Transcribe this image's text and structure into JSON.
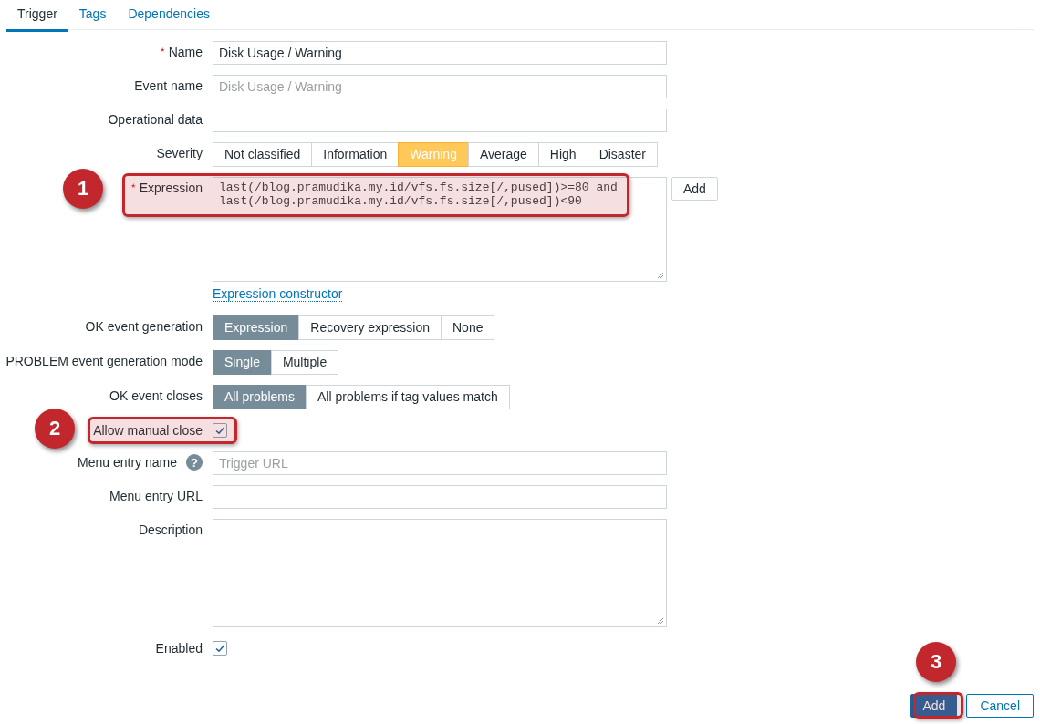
{
  "tabs": [
    {
      "label": "Trigger",
      "selected": true
    },
    {
      "label": "Tags",
      "selected": false
    },
    {
      "label": "Dependencies",
      "selected": false
    }
  ],
  "rows": [
    {
      "kind": "text",
      "label": "Name",
      "required": true,
      "value": "Disk Usage / Warning"
    },
    {
      "kind": "text",
      "label": "Event name",
      "required": false,
      "placeholder": "Disk Usage / Warning"
    },
    {
      "kind": "text",
      "label": "Operational data",
      "required": false
    },
    {
      "kind": "severity",
      "label": "Severity",
      "options": [
        {
          "label": "Not classified",
          "selected": false
        },
        {
          "label": "Information",
          "selected": false
        },
        {
          "label": "Warning",
          "selected": true
        },
        {
          "label": "Average",
          "selected": false
        },
        {
          "label": "High",
          "selected": false
        },
        {
          "label": "Disaster",
          "selected": false
        }
      ]
    },
    {
      "kind": "expression",
      "label": "Expression",
      "required": true,
      "value": "last(/blog.pramudika.my.id/vfs.fs.size[/,pused])>=80 and last(/blog.pramudika.my.id/vfs.fs.size[/,pused])<90",
      "button": "Add"
    },
    {
      "kind": "link",
      "text": "Expression constructor"
    },
    {
      "kind": "segmented",
      "label": "OK event generation",
      "options": [
        {
          "label": "Expression",
          "selected": true
        },
        {
          "label": "Recovery expression",
          "selected": false
        },
        {
          "label": "None",
          "selected": false
        }
      ]
    },
    {
      "kind": "segmented",
      "label": "PROBLEM event generation mode",
      "options": [
        {
          "label": "Single",
          "selected": true
        },
        {
          "label": "Multiple",
          "selected": false
        }
      ]
    },
    {
      "kind": "segmented",
      "label": "OK event closes",
      "options": [
        {
          "label": "All problems",
          "selected": true
        },
        {
          "label": "All problems if tag values match",
          "selected": false
        }
      ]
    },
    {
      "kind": "checkbox",
      "label": "Allow manual close",
      "checked": true
    },
    {
      "kind": "text",
      "label": "Menu entry name",
      "required": false,
      "help": "?",
      "placeholder": "Trigger URL"
    },
    {
      "kind": "text",
      "label": "Menu entry URL",
      "required": false
    },
    {
      "kind": "textarea",
      "label": "Description"
    },
    {
      "kind": "checkbox",
      "label": "Enabled",
      "checked": true
    }
  ],
  "buttons": [
    {
      "label": "Add",
      "primary": true
    },
    {
      "label": "Cancel",
      "primary": false
    }
  ],
  "annotations": [
    {
      "number": "1"
    },
    {
      "number": "2"
    },
    {
      "number": "3"
    }
  ]
}
